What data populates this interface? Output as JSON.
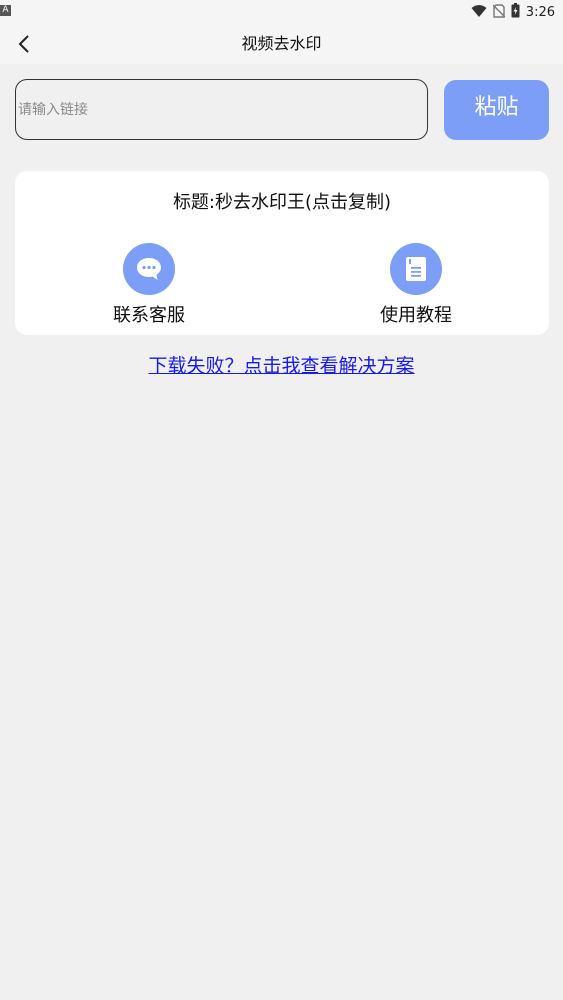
{
  "status_bar": {
    "left_icon_text": "A",
    "time": "3:26"
  },
  "app_bar": {
    "title": "视频去水印",
    "back_icon": "chevron-left-icon"
  },
  "input": {
    "placeholder": "请输入链接",
    "value": ""
  },
  "paste_button": {
    "label": "粘贴"
  },
  "card": {
    "title": "标题:秒去水印王(点击复制)",
    "actions": [
      {
        "label": "联系客服",
        "icon": "chat-bubble-icon"
      },
      {
        "label": "使用教程",
        "icon": "document-icon"
      }
    ]
  },
  "help_link": {
    "text": "下载失败？点击我查看解决方案"
  },
  "colors": {
    "accent": "#7d9ef7",
    "link": "#1a1ae6",
    "background": "#f0f0f0"
  }
}
